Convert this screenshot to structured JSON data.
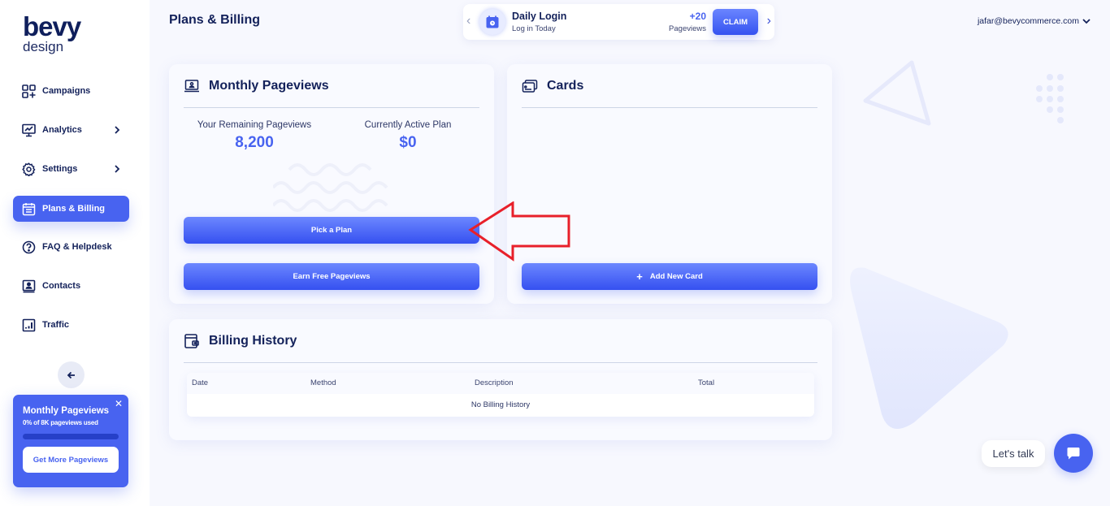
{
  "brand": {
    "name": "bevy",
    "sub": "design"
  },
  "sidebar": {
    "items": [
      {
        "label": "Campaigns",
        "icon": "grid-plus-icon",
        "has_children": false,
        "active": false
      },
      {
        "label": "Analytics",
        "icon": "monitor-chart-icon",
        "has_children": true,
        "active": false
      },
      {
        "label": "Settings",
        "icon": "gear-icon",
        "has_children": true,
        "active": false
      },
      {
        "label": "Plans & Billing",
        "icon": "calendar-icon",
        "has_children": false,
        "active": true
      },
      {
        "label": "FAQ & Helpdesk",
        "icon": "question-circle-icon",
        "has_children": false,
        "active": false
      },
      {
        "label": "Contacts",
        "icon": "contact-card-icon",
        "has_children": false,
        "active": false
      },
      {
        "label": "Traffic",
        "icon": "bar-chart-icon",
        "has_children": false,
        "active": false
      }
    ],
    "collapse_icon": "arrow-left-icon",
    "promo": {
      "title": "Monthly Pageviews",
      "usage_text": "0% of 8K pageviews used",
      "usage_percent": 0,
      "cta_label": "Get More Pageviews",
      "close_glyph": "✕"
    }
  },
  "header": {
    "title": "Plans & Billing",
    "daily_login": {
      "title": "Daily Login",
      "subtitle": "Log in Today",
      "reward": "+20",
      "reward_unit": "Pageviews",
      "claim_label": "CLAIM",
      "prev_glyph": "‹",
      "next_glyph": "›"
    },
    "user_email": "jafar@bevycommerce.com"
  },
  "pageviews_card": {
    "title": "Monthly Pageviews",
    "remaining_label": "Your Remaining Pageviews",
    "remaining_value": "8,200",
    "plan_label": "Currently Active Plan",
    "plan_value": "$0",
    "pick_plan_label": "Pick a Plan",
    "earn_label": "Earn Free Pageviews"
  },
  "cards_card": {
    "title": "Cards",
    "add_label": "Add New Card",
    "add_glyph": "+"
  },
  "billing_card": {
    "title": "Billing History",
    "columns": [
      "Date",
      "Method",
      "Description",
      "Total"
    ],
    "empty_text": "No Billing History"
  },
  "chat": {
    "label": "Let's talk"
  },
  "colors": {
    "accent": "#4863f0",
    "navy": "#13215a",
    "background": "#f7f8fe",
    "annotation": "#e8202a"
  }
}
